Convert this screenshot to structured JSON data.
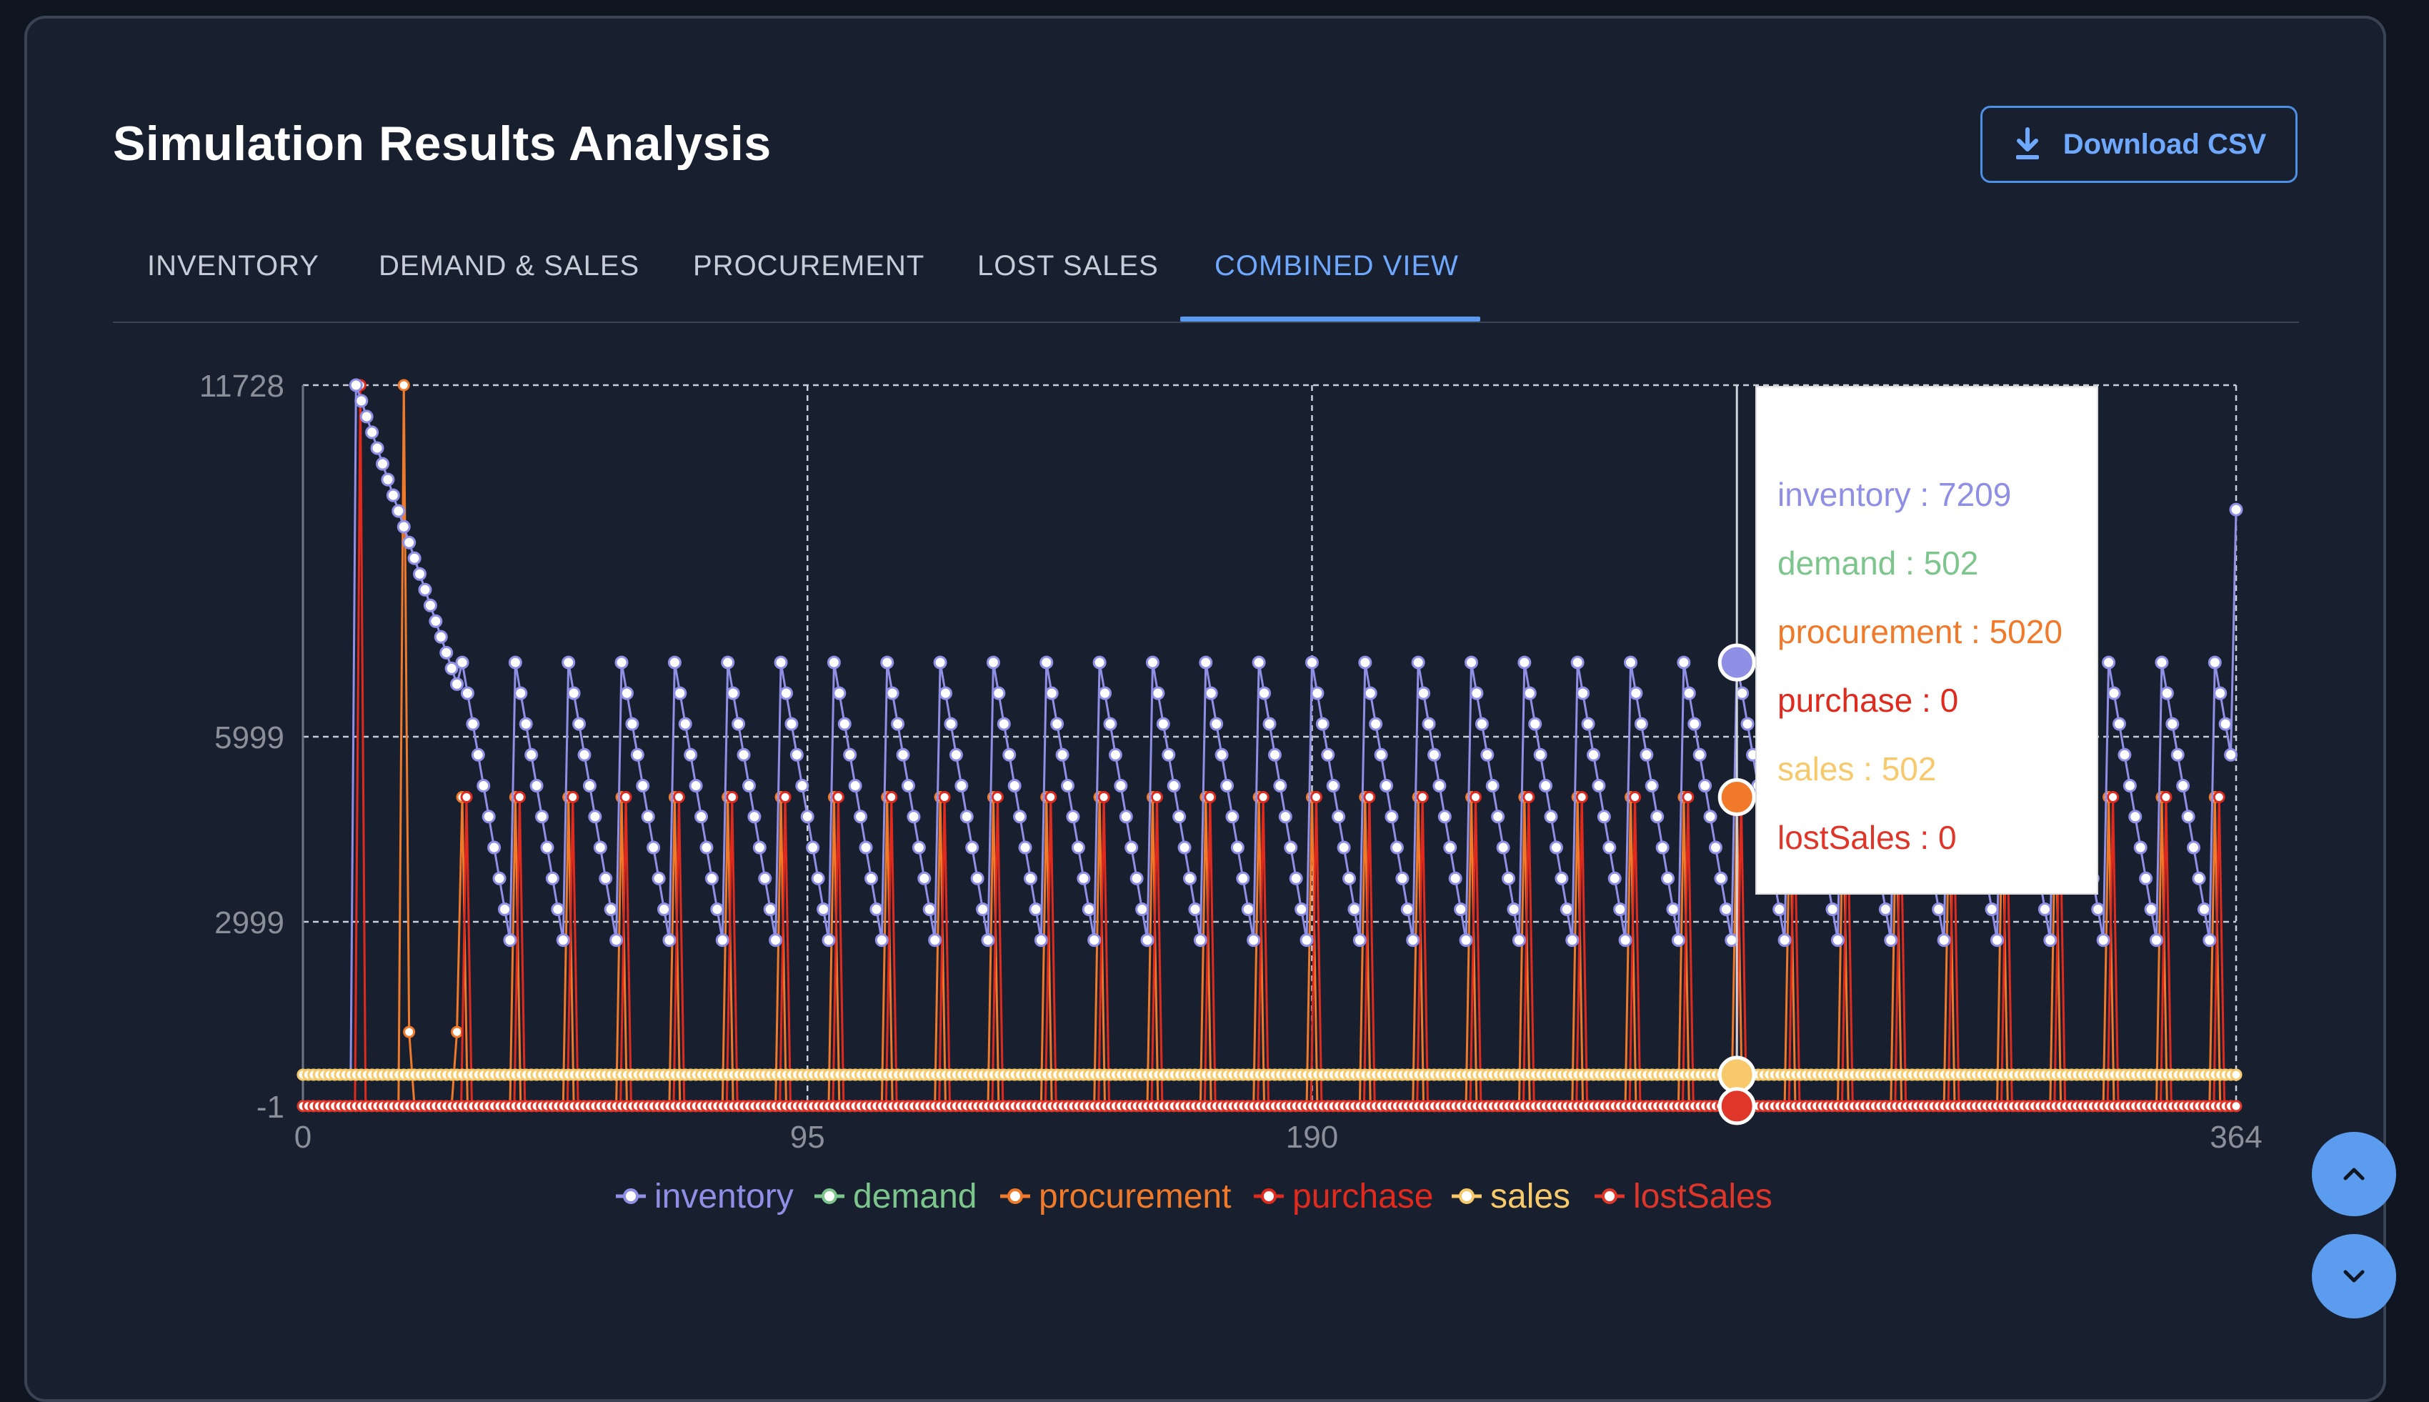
{
  "header": {
    "title": "Simulation Results Analysis",
    "download_label": "Download CSV"
  },
  "tabs": [
    {
      "label": "INVENTORY",
      "active": false
    },
    {
      "label": "DEMAND & SALES",
      "active": false
    },
    {
      "label": "PROCUREMENT",
      "active": false
    },
    {
      "label": "LOST SALES",
      "active": false
    },
    {
      "label": "COMBINED VIEW",
      "active": true
    }
  ],
  "icons": {
    "download": "download-icon",
    "scroll_up": "chevron-up-icon",
    "scroll_down": "chevron-down-icon"
  },
  "colors": {
    "accent": "#5a9bf0",
    "inventory": "#8f8fe6",
    "demand": "#7cc58c",
    "procurement": "#f07a2a",
    "purchase": "#e02a1e",
    "sales": "#f7c96a",
    "lostSales": "#e0362a"
  },
  "chart_data": {
    "type": "line",
    "x_ticks": [
      "0",
      "95",
      "190",
      "364"
    ],
    "y_ticks": [
      "11728",
      "5999",
      "2999",
      "-1"
    ],
    "xlim": [
      0,
      364
    ],
    "ylim": [
      -1,
      11728
    ],
    "grid": true,
    "legend_position": "bottom",
    "series": [
      {
        "name": "inventory",
        "pattern": {
          "initial_peak": 11728,
          "decay_to": 6600,
          "cycle_max": 7209,
          "cycle_min": 2700,
          "cycle_days": 10,
          "final": 9700
        }
      },
      {
        "name": "demand",
        "constant": 502
      },
      {
        "name": "procurement",
        "spike_value": 5020,
        "first_spike": 11728,
        "spike_every_days": 10
      },
      {
        "name": "purchase",
        "spike_value": 5020,
        "first_spike": 11728,
        "spike_every_days": 10
      },
      {
        "name": "sales",
        "constant": 502
      },
      {
        "name": "lostSales",
        "constant": 0
      }
    ],
    "tooltip": {
      "day": 270,
      "entries": [
        {
          "label": "inventory : 7209",
          "series": "inventory"
        },
        {
          "label": "demand : 502",
          "series": "demand"
        },
        {
          "label": "procurement : 5020",
          "series": "procurement"
        },
        {
          "label": "purchase : 0",
          "series": "purchase"
        },
        {
          "label": "sales : 502",
          "series": "sales"
        },
        {
          "label": "lostSales : 0",
          "series": "lostSales"
        }
      ]
    }
  }
}
